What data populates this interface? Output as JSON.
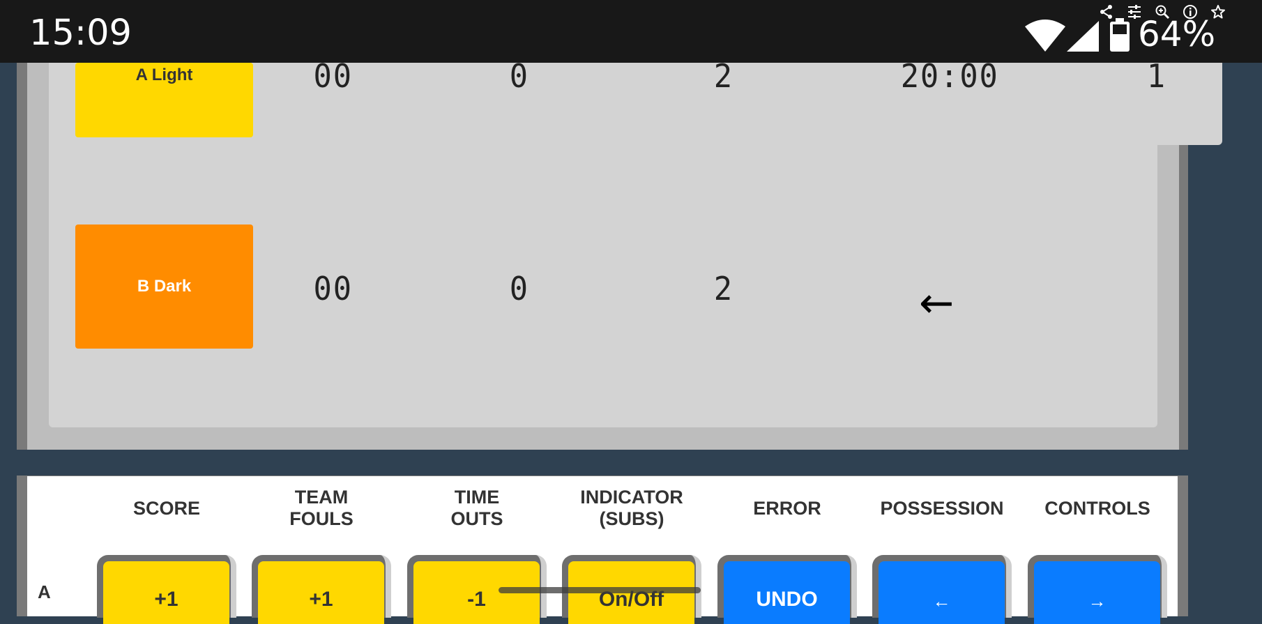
{
  "status_bar": {
    "time": "15:09",
    "battery_percent": "64%",
    "icons": [
      "share-icon",
      "tune-icon",
      "zoom-in-icon",
      "info-icon",
      "star-icon",
      "wifi-icon",
      "signal-icon",
      "battery-icon"
    ]
  },
  "scoreboard": {
    "team_a": {
      "name": "A Light",
      "score": "00",
      "timeouts": "0",
      "fouls_or_bonus": "2",
      "color": "#ffd800"
    },
    "team_b": {
      "name": "B Dark",
      "score": "00",
      "timeouts": "0",
      "fouls_or_bonus": "2",
      "color": "#ff8c00"
    },
    "clock": "20:00",
    "period": "1",
    "possession_arrow": "←"
  },
  "controls": {
    "headers": [
      {
        "line1": "SCORE",
        "line2": ""
      },
      {
        "line1": "TEAM",
        "line2": "FOULS"
      },
      {
        "line1": "TIME",
        "line2": "OUTS"
      },
      {
        "line1": "INDICATOR",
        "line2": "(SUBS)"
      },
      {
        "line1": "ERROR",
        "line2": ""
      },
      {
        "line1": "POSSESSION",
        "line2": ""
      },
      {
        "line1": "CONTROLS",
        "line2": ""
      }
    ],
    "row_a": {
      "label": "A",
      "buttons": [
        "+1",
        "+1",
        "-1",
        "On/Off",
        "UNDO",
        "←",
        "→"
      ]
    }
  },
  "colors": {
    "yellow": "#ffd800",
    "blue": "#0a7cff",
    "orange": "#ff8c00",
    "background": "#2f4152"
  }
}
